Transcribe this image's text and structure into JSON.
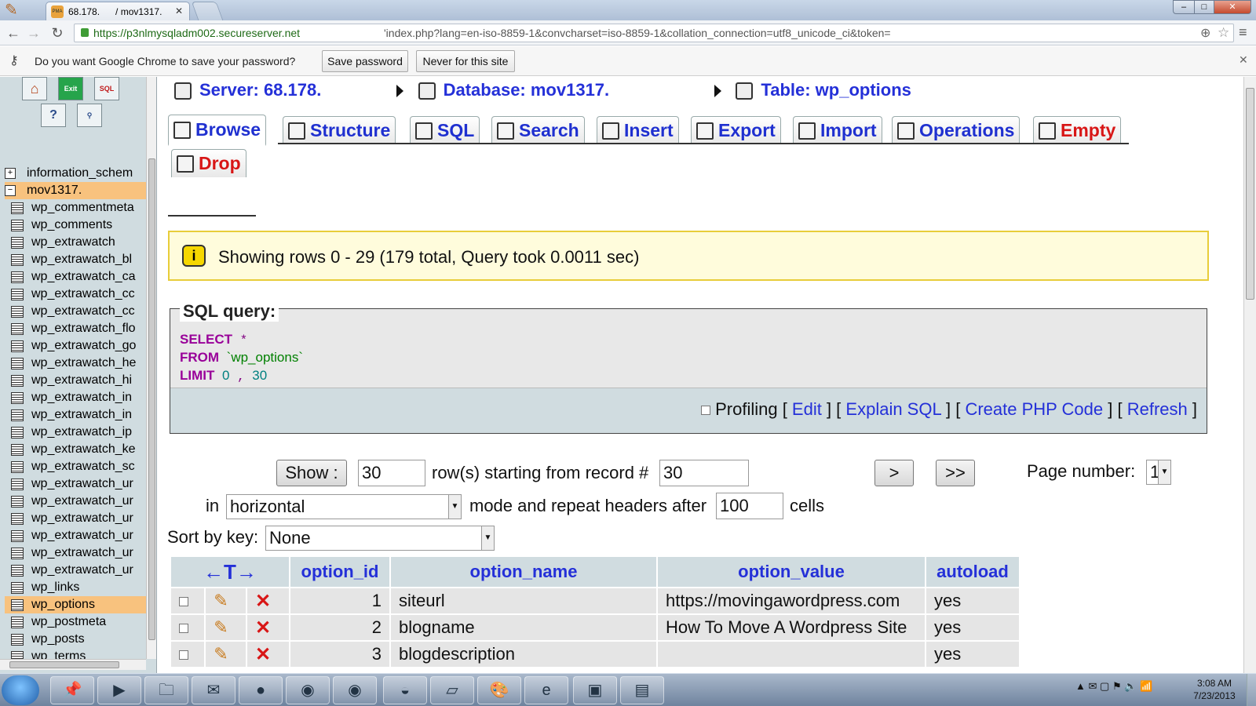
{
  "browser": {
    "tab_title": "68.178.",
    "tab_title_2": "/ mov1317.",
    "favicon": "PMA",
    "url_host": "https://p3nlmysqladm002.secureserver.net",
    "url_path": "'index.php?lang=en-iso-8859-1&convcharset=iso-8859-1&collation_connection=utf8_unicode_ci&token=",
    "password_prompt": "Do you want Google Chrome to save your password?",
    "save_password": "Save password",
    "never_for_site": "Never for this site"
  },
  "leftnav": {
    "icons": [
      "home-icon",
      "exit-icon",
      "sql-icon",
      "help-icon",
      "sql-search-icon"
    ],
    "exit_label": "Exit",
    "sql_label": "SQL",
    "databases": [
      {
        "toggle": "+",
        "name": "information_schem"
      },
      {
        "toggle": "−",
        "name": "mov1317."
      }
    ],
    "tables": [
      "wp_commentmeta",
      "wp_comments",
      "wp_extrawatch",
      "wp_extrawatch_bl",
      "wp_extrawatch_ca",
      "wp_extrawatch_cc",
      "wp_extrawatch_cc",
      "wp_extrawatch_flo",
      "wp_extrawatch_go",
      "wp_extrawatch_he",
      "wp_extrawatch_hi",
      "wp_extrawatch_in",
      "wp_extrawatch_in",
      "wp_extrawatch_ip",
      "wp_extrawatch_ke",
      "wp_extrawatch_sc",
      "wp_extrawatch_ur",
      "wp_extrawatch_ur",
      "wp_extrawatch_ur",
      "wp_extrawatch_ur",
      "wp_extrawatch_ur",
      "wp_extrawatch_ur",
      "wp_links",
      "wp_options",
      "wp_postmeta",
      "wp_posts",
      "wp_terms"
    ],
    "selected_table": "wp_options"
  },
  "breadcrumb": {
    "server": "Server: 68.178.",
    "database": "Database: mov1317.",
    "table": "Table: wp_options"
  },
  "tabs": [
    "Browse",
    "Structure",
    "SQL",
    "Search",
    "Insert",
    "Export",
    "Import",
    "Operations",
    "Empty",
    "Drop"
  ],
  "notice": "Showing rows 0 - 29 (179 total, Query took 0.0011 sec)",
  "sql": {
    "legend": "SQL query:",
    "select": "SELECT",
    "star": "*",
    "from": "FROM",
    "table": "`wp_options`",
    "limit": "LIMIT",
    "limit_start": "0",
    "comma": ",",
    "limit_count": "30",
    "profiling": "Profiling",
    "links": [
      "Edit",
      "Explain SQL",
      "Create PHP Code",
      "Refresh"
    ]
  },
  "navform": {
    "show_btn": "Show :",
    "rows": "30",
    "rows_label": "row(s) starting from record #",
    "start": "30",
    "next_btn": ">",
    "last_btn": ">>",
    "page_label": "Page number:",
    "page_value": "1",
    "in_label": "in",
    "mode": "horizontal",
    "mode_label": "mode and repeat headers after",
    "repeat": "100",
    "cells_label": "cells",
    "sort_label": "Sort by key:",
    "sort_value": "None"
  },
  "table": {
    "columns": [
      "option_id",
      "option_name",
      "option_value",
      "autoload"
    ],
    "rows": [
      {
        "option_id": "1",
        "option_name": "siteurl",
        "option_value": "https://movingawordpress.com",
        "autoload": "yes"
      },
      {
        "option_id": "2",
        "option_name": "blogname",
        "option_value": "How To Move A Wordpress Site",
        "autoload": "yes"
      },
      {
        "option_id": "3",
        "option_name": "blogdescription",
        "option_value": "",
        "autoload": "yes"
      }
    ]
  },
  "taskbar": {
    "clock_time": "3:08 AM",
    "clock_date": "7/23/2013"
  }
}
